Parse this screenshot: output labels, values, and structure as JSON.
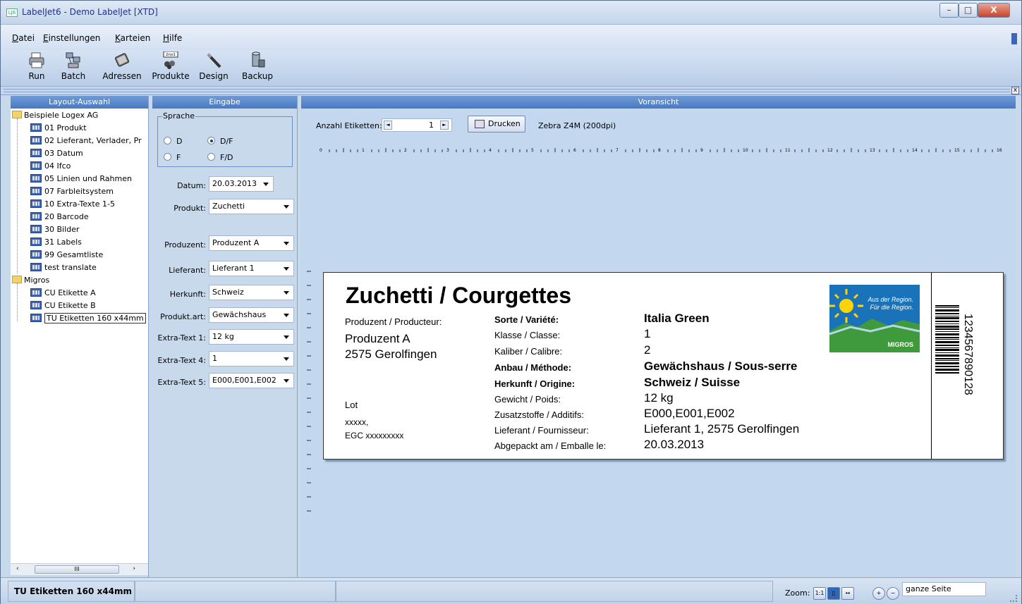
{
  "window": {
    "title": "LabelJet6 - Demo LabelJet [XTD]",
    "icon_text": "LJ6",
    "controls": [
      "–",
      "□",
      "X"
    ]
  },
  "menu": [
    "Datei",
    "Einstellungen",
    "Karteien",
    "Hilfe"
  ],
  "toolbar": {
    "run": "Run",
    "batch": "Batch",
    "adressen": "Adressen",
    "produkte": "Produkte",
    "produkte_badge": "2ros1",
    "design": "Design",
    "backup": "Backup"
  },
  "splitter_close": "x",
  "panes": {
    "layout": "Layout-Auswahl",
    "eingabe": "Eingabe",
    "preview": "Voransicht"
  },
  "tree": {
    "group1": "Beispiele Logex AG",
    "group1_items": [
      "01 Produkt",
      "02 Lieferant, Verlader, Pr",
      "03 Datum",
      "04 Ifco",
      "05 Linien und Rahmen",
      "07 Farbleitsystem",
      "10 Extra-Texte 1-5",
      "20 Barcode",
      "30 Bilder",
      "31 Labels",
      "99 Gesamtliste",
      "test translate"
    ],
    "group2": "Migros",
    "group2_items": [
      "CU Etikette A",
      "CU Etikette B",
      "TU Etiketten 160 x44mm"
    ],
    "selected": "TU Etiketten 160 x44mm"
  },
  "scroll_grip": "III",
  "form": {
    "sprache_title": "Sprache",
    "radios": [
      "D",
      "D/F",
      "F",
      "F/D"
    ],
    "selected_radio": "D/F",
    "fields": [
      {
        "label": "Datum:",
        "value": "20.03.2013"
      },
      {
        "label": "Produkt:",
        "value": "Zuchetti"
      },
      {
        "label": "Produzent:",
        "value": "Produzent A"
      },
      {
        "label": "Lieferant:",
        "value": "Lieferant 1"
      },
      {
        "label": "Herkunft:",
        "value": "Schweiz"
      },
      {
        "label": "Produkt.art:",
        "value": "Gewächshaus"
      },
      {
        "label": "Extra-Text 1:",
        "value": "12 kg"
      },
      {
        "label": "Extra-Text 4:",
        "value": "1"
      },
      {
        "label": "Extra-Text 5:",
        "value": "E000,E001,E002"
      }
    ]
  },
  "preview": {
    "count_label": "Anzahl Etiketten:",
    "count_value": "1",
    "print_button": "Drucken",
    "printer": "Zebra  Z4M (200dpi)",
    "ruler_marks": [
      "0",
      "1",
      "2",
      "3",
      "4",
      "5",
      "6",
      "7",
      "8",
      "9",
      "10",
      "11",
      "12",
      "13",
      "14",
      "15",
      "16"
    ]
  },
  "label": {
    "title": "Zuchetti  / Courgettes",
    "producer_head": "Produzent / Producteur:",
    "producer_name": "Produzent A",
    "producer_city": "2575  Gerolfingen",
    "lot": "Lot",
    "lot_value": "xxxxx,",
    "egc": "EGC xxxxxxxxx",
    "rows": [
      {
        "key": "Sorte / Variété:",
        "value": "Italia Green",
        "bold": true
      },
      {
        "key": "Klasse / Classe:",
        "value": "1",
        "bold": false
      },
      {
        "key": "Kaliber / Calibre:",
        "value": "2",
        "bold": false
      },
      {
        "key": "Anbau / Méthode:",
        "value": "Gewächshaus / Sous-serre",
        "bold": true
      },
      {
        "key": "Herkunft / Origine:",
        "value": "Schweiz / Suisse",
        "bold": true
      },
      {
        "key": "Gewicht / Poids:",
        "value": "12 kg",
        "bold": false
      },
      {
        "key": "Zusatzstoffe / Additifs:",
        "value": "E000,E001,E002",
        "bold": false
      },
      {
        "key": "Lieferant / Fournisseur:",
        "value": "Lieferant 1, 2575 Gerolfingen",
        "bold": false
      },
      {
        "key": "Abgepackt am / Emballe le:",
        "value": "20.03.2013",
        "bold": false
      }
    ],
    "logo_line1": "Aus der Region.",
    "logo_line2": "Für die Region.",
    "logo_brand": "MIGROS",
    "barcode_number": "1234567890128"
  },
  "status": {
    "layout_name": "TU Etiketten 160 x44mm",
    "zoom_label": "Zoom:",
    "zoom_value": "ganze Seite"
  }
}
